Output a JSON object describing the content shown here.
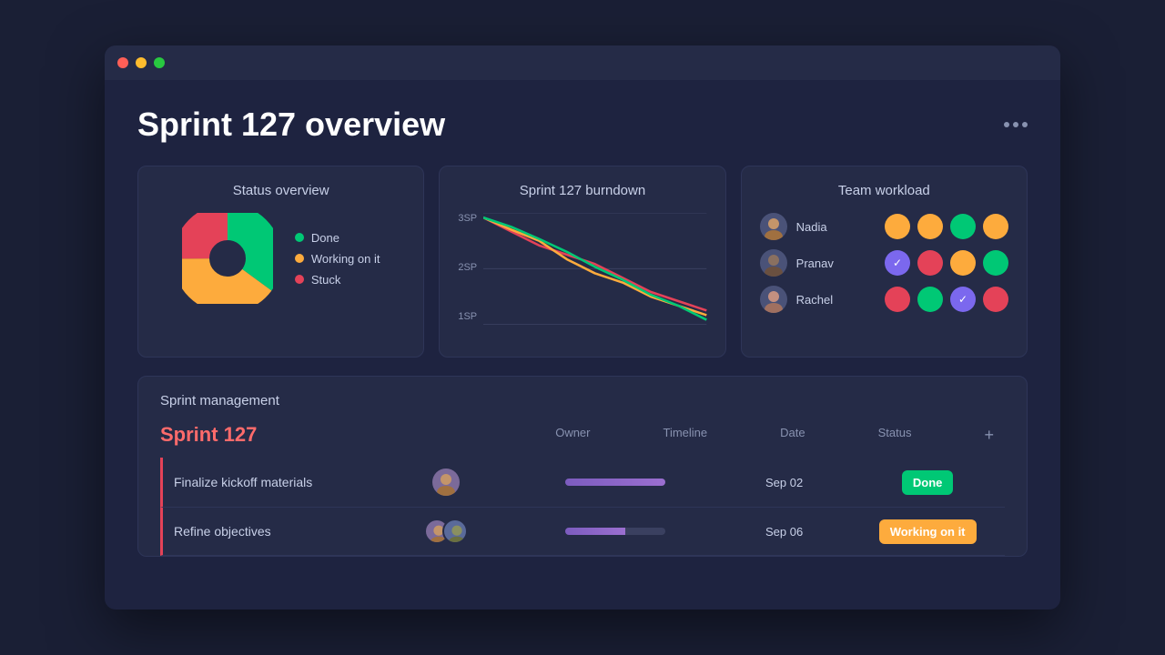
{
  "window": {
    "titlebar": {
      "dots": [
        "red",
        "yellow",
        "green"
      ]
    }
  },
  "header": {
    "title": "Sprint 127 overview",
    "more_label": "···"
  },
  "status_card": {
    "title": "Status overview",
    "legend": [
      {
        "label": "Done",
        "color": "#00c875"
      },
      {
        "label": "Working on it",
        "color": "#fdab3d"
      },
      {
        "label": "Stuck",
        "color": "#e44258"
      }
    ]
  },
  "burndown_card": {
    "title": "Sprint 127 burndown",
    "y_labels": [
      "3SP",
      "2SP",
      "1SP"
    ]
  },
  "workload_card": {
    "title": "Team workload",
    "rows": [
      {
        "name": "Nadia",
        "circles": [
          {
            "color": "#fdab3d",
            "icon": ""
          },
          {
            "color": "#fdab3d",
            "icon": ""
          },
          {
            "color": "#00c875",
            "icon": ""
          },
          {
            "color": "#fdab3d",
            "icon": ""
          }
        ]
      },
      {
        "name": "Pranav",
        "circles": [
          {
            "color": "#7b68ee",
            "icon": "✓"
          },
          {
            "color": "#e44258",
            "icon": ""
          },
          {
            "color": "#fdab3d",
            "icon": ""
          },
          {
            "color": "#00c875",
            "icon": ""
          }
        ]
      },
      {
        "name": "Rachel",
        "circles": [
          {
            "color": "#e44258",
            "icon": ""
          },
          {
            "color": "#00c875",
            "icon": ""
          },
          {
            "color": "#7b68ee",
            "icon": "✓"
          },
          {
            "color": "#e44258",
            "icon": ""
          }
        ]
      }
    ]
  },
  "management": {
    "title": "Sprint management",
    "sprint_name": "Sprint 127",
    "columns": [
      "",
      "Owner",
      "Timeline",
      "Date",
      "Status",
      "+"
    ],
    "rows": [
      {
        "task": "Finalize kickoff materials",
        "owner_type": "single",
        "date": "Sep 02",
        "status": "Done",
        "status_class": "done",
        "timeline_type": "full"
      },
      {
        "task": "Refine objectives",
        "owner_type": "double",
        "date": "Sep 06",
        "status": "Working on it",
        "status_class": "working",
        "timeline_type": "partial"
      }
    ]
  }
}
